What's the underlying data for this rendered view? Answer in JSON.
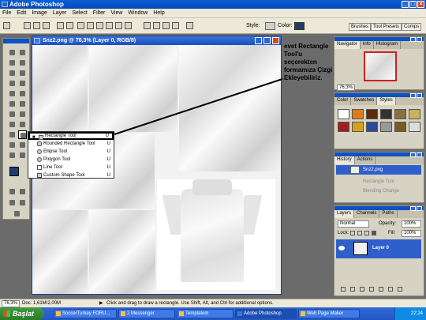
{
  "app": {
    "title": "Adobe Photoshop"
  },
  "menu": [
    "File",
    "Edit",
    "Image",
    "Layer",
    "Select",
    "Filter",
    "View",
    "Window",
    "Help"
  ],
  "options_bar": {
    "style_label": "Style:",
    "color_label": "Color:",
    "color_value": "#1f3d68"
  },
  "palette_well_tabs": [
    "Brushes",
    "Tool Presets",
    "Comps"
  ],
  "document": {
    "title": "Snz2.png @ 76,3% (Layer 0, RGB/8)"
  },
  "tool_flyout": {
    "items": [
      {
        "label": "Rectangle Tool",
        "key": "U",
        "active": true,
        "icon": "rectangle-icon"
      },
      {
        "label": "Rounded Rectangle Tool",
        "key": "U",
        "active": false,
        "icon": "rounded-rectangle-icon"
      },
      {
        "label": "Ellipse Tool",
        "key": "U",
        "active": false,
        "icon": "ellipse-icon"
      },
      {
        "label": "Polygon Tool",
        "key": "U",
        "active": false,
        "icon": "polygon-icon"
      },
      {
        "label": "Line Tool",
        "key": "U",
        "active": false,
        "icon": "line-icon"
      },
      {
        "label": "Custom Shape Tool",
        "key": "U",
        "active": false,
        "icon": "custom-shape-icon"
      }
    ]
  },
  "annotation": {
    "text": "evet Rectangle Tool'u seçerekten formamıza Çizgi Ekleyebiliriz."
  },
  "navigator": {
    "tabs": [
      "Navigator",
      "Info",
      "Histogram"
    ],
    "zoom": "76,3%"
  },
  "styles_panel": {
    "tabs": [
      "Color",
      "Swatches",
      "Styles"
    ]
  },
  "history": {
    "tabs": [
      "History",
      "Actions"
    ],
    "items": [
      {
        "label": "Snz2.png",
        "state": "selected"
      },
      {
        "label": "Rectangle Tool",
        "state": "dim"
      },
      {
        "label": "Blending Change",
        "state": "dim"
      }
    ]
  },
  "layers": {
    "tabs": [
      "Layers",
      "Channels",
      "Paths"
    ],
    "blend_mode": "Normal",
    "opacity_label": "Opacity:",
    "opacity": "100%",
    "lock_label": "Lock:",
    "fill_label": "Fill:",
    "fill": "100%",
    "layer_name": "Layer 0"
  },
  "status": {
    "zoom": "76,3%",
    "doc": "Doc: 1,61M/2,00M",
    "hint": "Click and drag to draw a rectangle.  Use Shift, Alt, and Ctrl for additional options."
  },
  "taskbar": {
    "start_label": "Başlat",
    "tasks": [
      "SoccerTurkey FORU...",
      "2 Messenger",
      "Templatem",
      "Adobe Photoshop",
      "Web Page Maker"
    ],
    "active_task": "Adobe Photoshop",
    "clock": "22:24"
  }
}
